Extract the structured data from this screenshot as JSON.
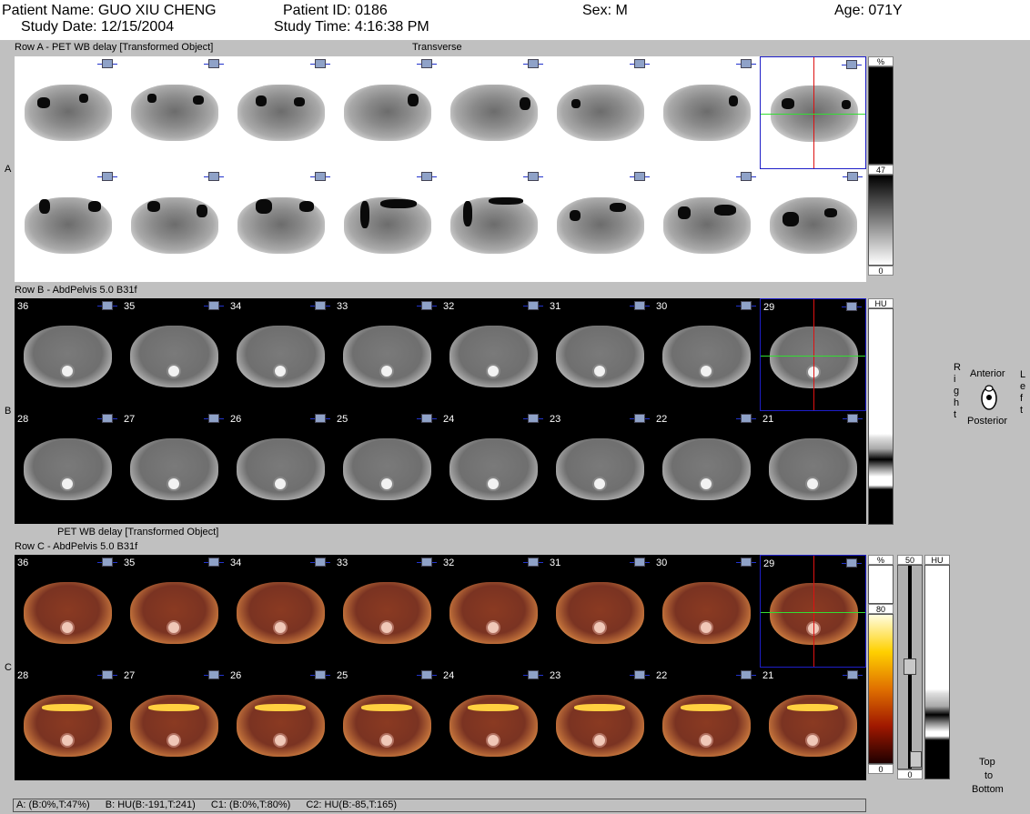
{
  "header": {
    "patient_name": "Patient Name:  GUO XIU CHENG",
    "patient_id": "Patient ID:  0186",
    "sex": "Sex:  M",
    "age": "Age:  071Y",
    "study_date": "Study Date:  12/15/2004",
    "study_time": "Study Time:  4:16:38 PM"
  },
  "row_a": {
    "title": "Row A - PET WB delay [Transformed Object]",
    "view": "Transverse",
    "side_label": "A",
    "bar": {
      "top": "%",
      "mid": "47",
      "bottom": "0"
    },
    "level_percent": 47
  },
  "row_b": {
    "title": "Row B - AbdPelvis  5.0  B31f",
    "side_label": "B",
    "slices_top": [
      "36",
      "35",
      "34",
      "33",
      "32",
      "31",
      "30",
      "29"
    ],
    "slices_bottom": [
      "28",
      "27",
      "26",
      "25",
      "24",
      "23",
      "22",
      "21"
    ],
    "bar": {
      "top": "HU"
    }
  },
  "row_c": {
    "title_top": "PET WB delay [Transformed Object]",
    "title": "Row C - AbdPelvis  5.0  B31f",
    "side_label": "C",
    "slices_top": [
      "36",
      "35",
      "34",
      "33",
      "32",
      "31",
      "30",
      "29"
    ],
    "slices_bottom": [
      "28",
      "27",
      "26",
      "25",
      "24",
      "23",
      "22",
      "21"
    ],
    "pet_bar": {
      "top": "%",
      "mid": "80",
      "bottom": "0"
    },
    "blend_bar": {
      "top": "50",
      "bottom": "0"
    },
    "ct_bar": {
      "top": "HU"
    },
    "level_percent": 80
  },
  "orientation": {
    "right": [
      "R",
      "i",
      "g",
      "h",
      "t"
    ],
    "left": [
      "L",
      "e",
      "f",
      "t"
    ],
    "anterior": "Anterior",
    "posterior": "Posterior"
  },
  "order": {
    "line1": "Top",
    "line2": "to",
    "line3": "Bottom"
  },
  "status": {
    "a": "A: (B:0%,T:47%)",
    "b": "B: HU(B:-191,T:241)",
    "c1": "C1: (B:0%,T:80%)",
    "c2": "C2: HU(B:-85,T:165)"
  },
  "colors": {
    "crosshair_v": "#dd1111",
    "crosshair_h": "#33dd33",
    "selection": "#1e1ec8",
    "header_bg": "#ffffff",
    "panel_bg": "#c0c0c0"
  }
}
